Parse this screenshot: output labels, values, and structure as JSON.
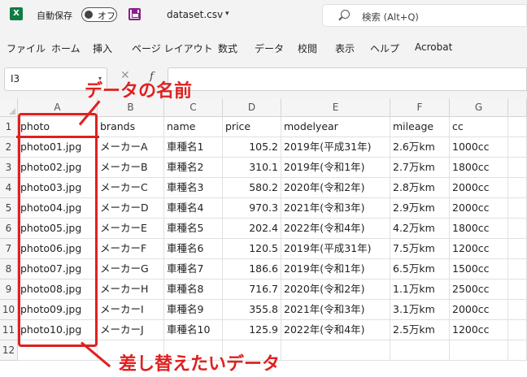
{
  "titlebar": {
    "app_icon": "excel-icon",
    "app_icon_letter": "X",
    "autosave_label": "自動保存",
    "autosave_state": "オフ",
    "filename": "dataset.csv",
    "filename_caret": "▾",
    "search_placeholder": "検索 (Alt+Q)"
  },
  "menu": [
    "ファイル",
    "ホーム",
    "挿入",
    "ページ レイアウト",
    "数式",
    "データ",
    "校閲",
    "表示",
    "ヘルプ",
    "Acrobat"
  ],
  "formula_bar": {
    "name_box": "I3",
    "name_caret": "▾",
    "cancel_glyph": "✕",
    "fx_glyph": "f"
  },
  "sheet": {
    "columns": [
      "A",
      "B",
      "C",
      "D",
      "E",
      "F",
      "G"
    ],
    "rows": [
      [
        "photo",
        "brands",
        "name",
        "price",
        "modelyear",
        "mileage",
        "cc"
      ],
      [
        "photo01.jpg",
        "メーカーA",
        "車種名1",
        "105.2",
        "2019年(平成31年)",
        "2.6万km",
        "1000cc"
      ],
      [
        "photo02.jpg",
        "メーカーB",
        "車種名2",
        "310.1",
        "2019年(令和1年)",
        "2.7万km",
        "1800cc"
      ],
      [
        "photo03.jpg",
        "メーカーC",
        "車種名3",
        "580.2",
        "2020年(令和2年)",
        "2.8万km",
        "2000cc"
      ],
      [
        "photo04.jpg",
        "メーカーD",
        "車種名4",
        "970.3",
        "2021年(令和3年)",
        "2.9万km",
        "2000cc"
      ],
      [
        "photo05.jpg",
        "メーカーE",
        "車種名5",
        "202.4",
        "2022年(令和4年)",
        "4.2万km",
        "1800cc"
      ],
      [
        "photo06.jpg",
        "メーカーF",
        "車種名6",
        "120.5",
        "2019年(平成31年)",
        "7.5万km",
        "1200cc"
      ],
      [
        "photo07.jpg",
        "メーカーG",
        "車種名7",
        "186.6",
        "2019年(令和1年)",
        "6.5万km",
        "1500cc"
      ],
      [
        "photo08.jpg",
        "メーカーH",
        "車種名8",
        "716.7",
        "2020年(令和2年)",
        "1.1万km",
        "2500cc"
      ],
      [
        "photo09.jpg",
        "メーカーI",
        "車種名9",
        "355.8",
        "2021年(令和3年)",
        "3.1万km",
        "2000cc"
      ],
      [
        "photo10.jpg",
        "メーカーJ",
        "車種名10",
        "125.9",
        "2022年(令和4年)",
        "2.5万km",
        "1200cc"
      ],
      [
        "",
        "",
        "",
        "",
        "",
        "",
        ""
      ]
    ],
    "row_numbers": [
      "1",
      "2",
      "3",
      "4",
      "5",
      "6",
      "7",
      "8",
      "9",
      "10",
      "11",
      "12"
    ]
  },
  "annotations": {
    "top_label": "データの名前",
    "bottom_label": "差し替えたいデータ",
    "color": "#e02020"
  },
  "colors": {
    "excel_green": "#107c41",
    "annotation_red": "#e02020"
  }
}
